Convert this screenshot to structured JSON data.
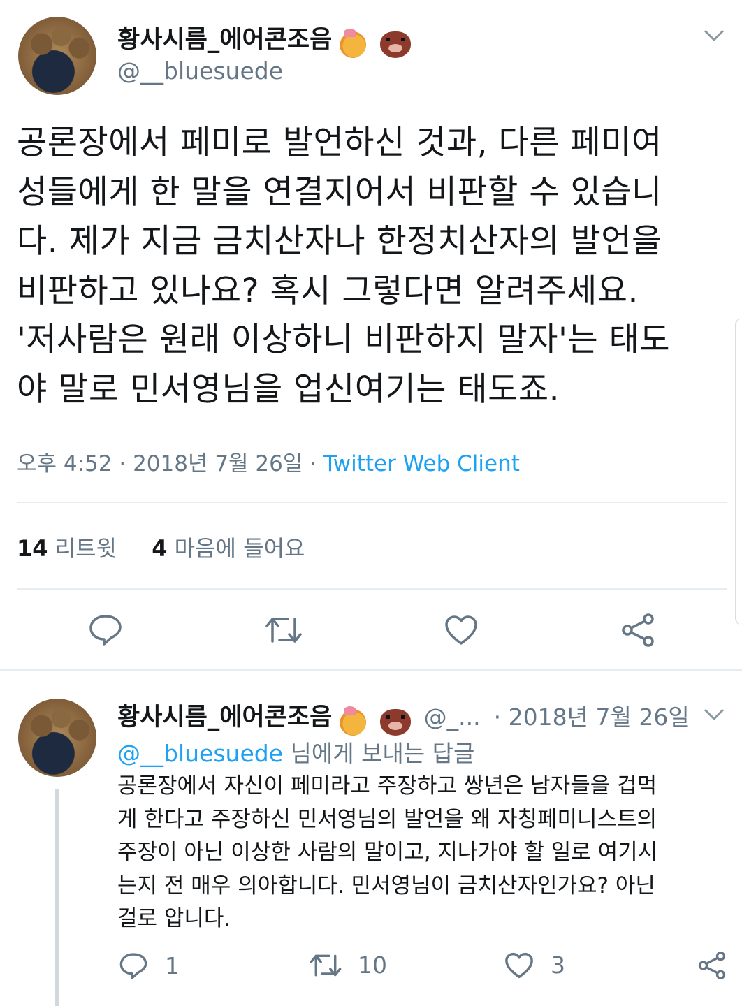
{
  "main_tweet": {
    "display_name": "황사시름_에어콘조음",
    "handle": "@__bluesuede",
    "text_lines": [
      "공론장에서 페미로 발언하신 것과, 다른 페미여",
      "성들에게 한 말을 연결지어서 비판할 수 있습니",
      "다. 제가 지금 금치산자나 한정치산자의 발언을",
      "비판하고 있나요? 혹시 그렇다면 알려주세요.",
      "'저사람은 원래 이상하니 비판하지 말자'는 태도",
      "야 말로 민서영님을 업신여기는 태도죠."
    ],
    "time": "오후 4:52 · 2018년 7월 26일 · ",
    "source": "Twitter Web Client",
    "retweet_count": "14",
    "retweet_label": "리트윗",
    "like_count": "4",
    "like_label": "마음에 들어요"
  },
  "reply_tweet": {
    "display_name": "황사시름_에어콘조음",
    "handle_truncated": "@_...",
    "date": "· 2018년 7월 26일",
    "reply_to_handle": "@__bluesuede",
    "reply_to_suffix": " 님에게 보내는 답글",
    "text_lines": [
      "공론장에서 자신이 페미라고 주장하고 쌍년은 남자들을 겁먹",
      "게 한다고 주장하신 민서영님의 발언을 왜 자칭페미니스트의",
      "주장이 아닌 이상한 사람의 말이고, 지나가야 할 일로 여기시",
      "는지 전 매우 의아합니다. 민서영님이 금치산자인가요? 아닌",
      "걸로 압니다."
    ],
    "reply_count": "1",
    "retweet_count": "10",
    "like_count": "3"
  },
  "icons": {
    "caret": "chevron-down-icon",
    "reply": "reply-icon",
    "retweet": "retweet-icon",
    "like": "heart-icon",
    "share": "share-icon"
  },
  "colors": {
    "link": "#1da1f2",
    "muted": "#657786",
    "text": "#14171a",
    "divider": "#e6ecf0"
  }
}
